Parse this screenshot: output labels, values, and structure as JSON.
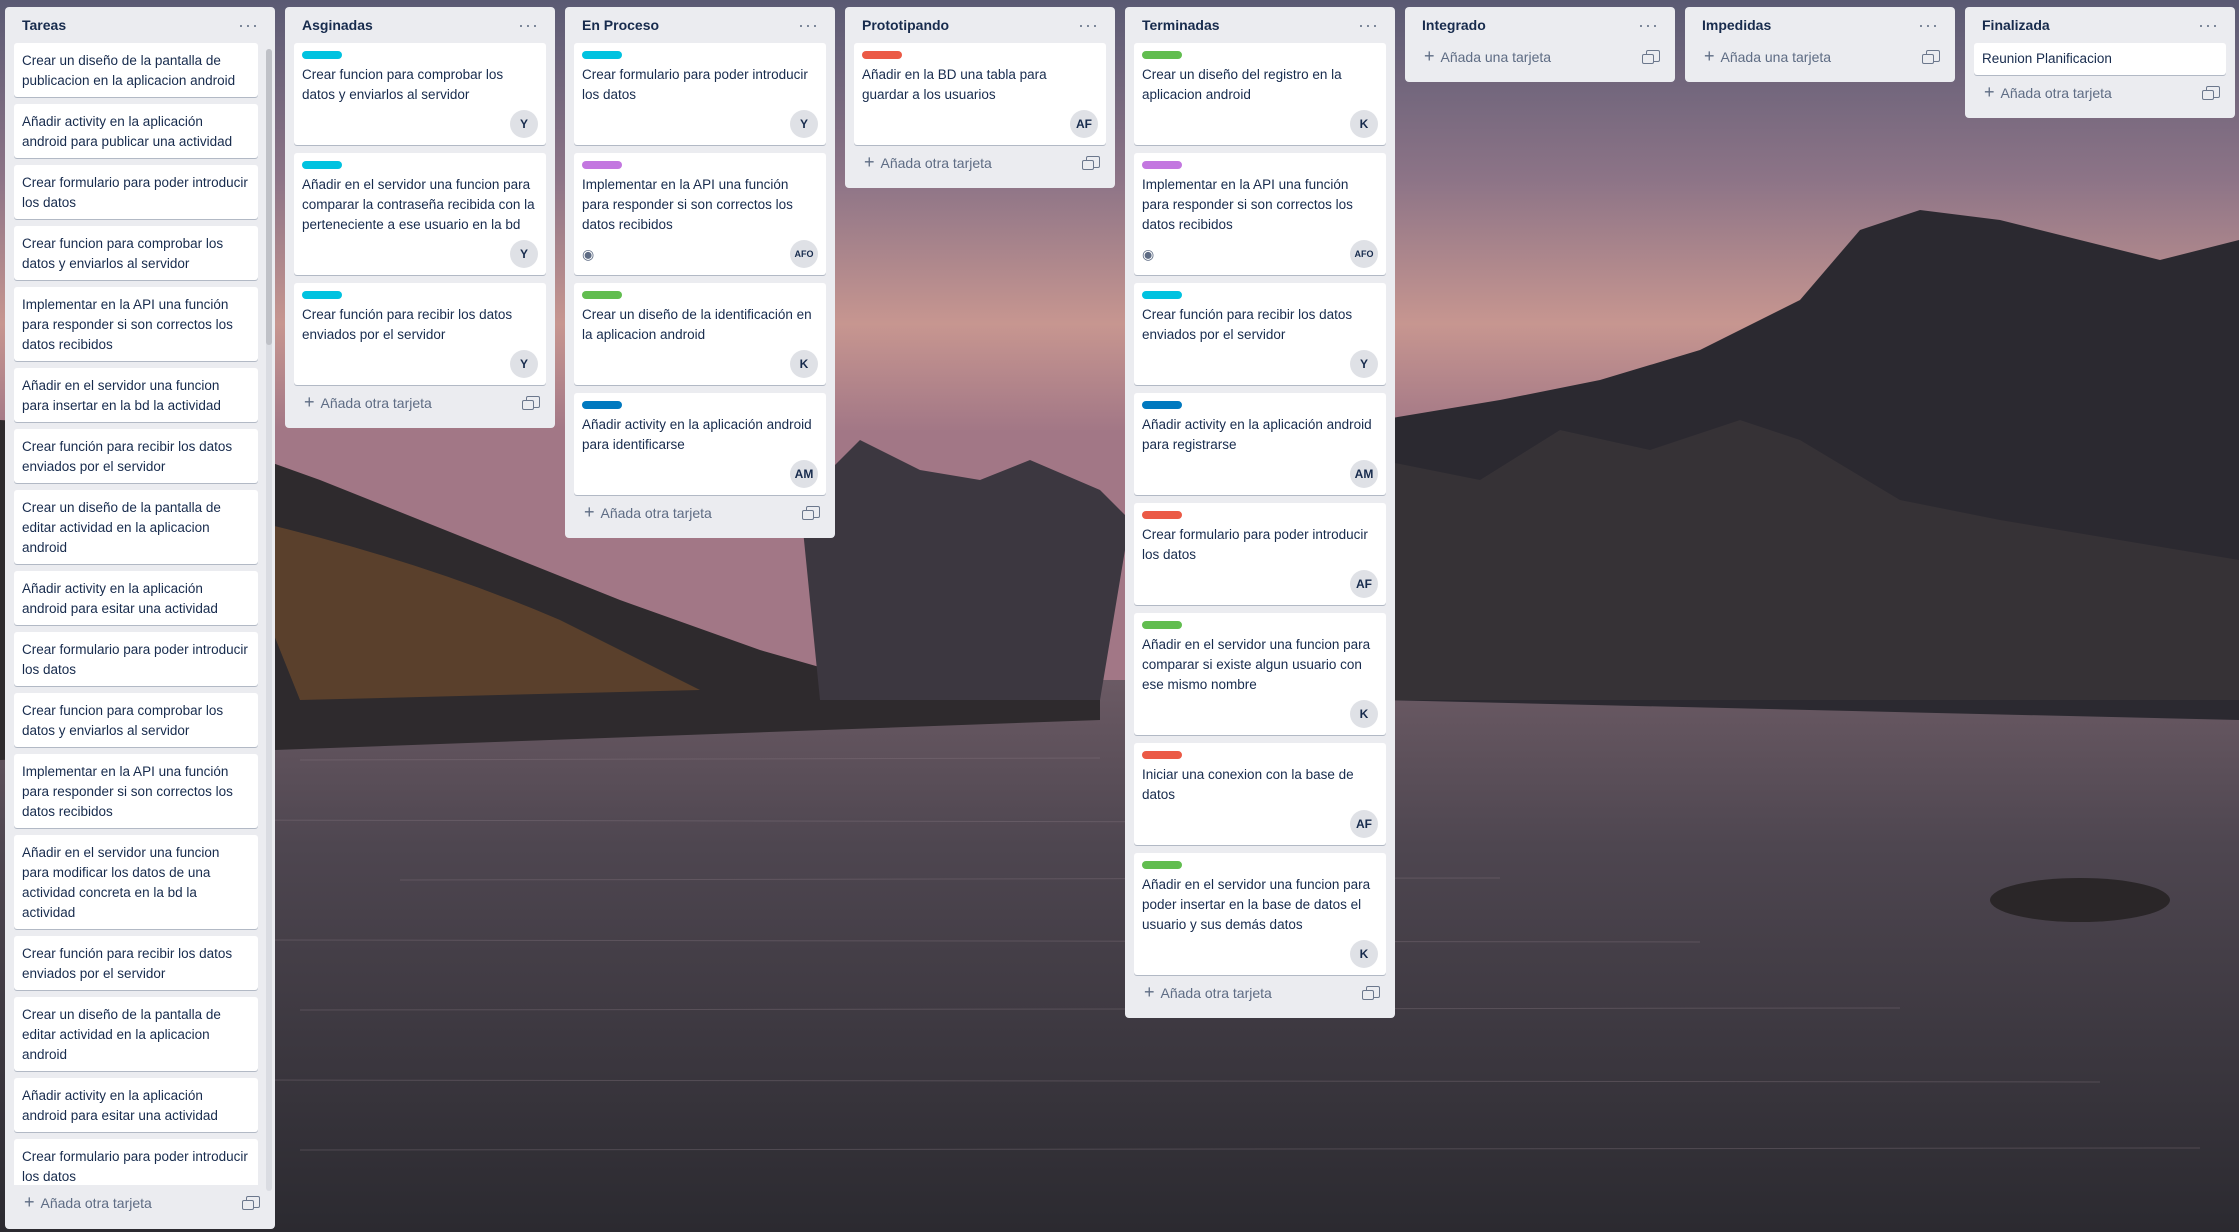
{
  "lists": [
    {
      "title": "Tareas",
      "add_label": "Añada otra tarjeta",
      "cards": [
        {
          "title": "Crear un diseño de la pantalla de publicacion en la aplicacion android"
        },
        {
          "title": "Añadir activity en la aplicación android para publicar una actividad"
        },
        {
          "title": "Crear formulario para poder introducir los datos"
        },
        {
          "title": "Crear funcion para comprobar los datos y enviarlos al servidor"
        },
        {
          "title": "Implementar en la API una función para responder si son correctos los datos recibidos"
        },
        {
          "title": "Añadir en el servidor una funcion para insertar en la bd la actividad"
        },
        {
          "title": "Crear función para recibir los datos enviados por el servidor"
        },
        {
          "title": "Crear un diseño de la pantalla de editar actividad en la aplicacion android"
        },
        {
          "title": "Añadir activity en la aplicación android para esitar una actividad"
        },
        {
          "title": "Crear formulario para poder introducir los datos"
        },
        {
          "title": "Crear funcion para comprobar los datos y enviarlos al servidor"
        },
        {
          "title": "Implementar en la API una función para responder si son correctos los datos recibidos"
        },
        {
          "title": "Añadir en el servidor una funcion para modificar los datos de una actividad concreta en la bd la actividad"
        },
        {
          "title": "Crear función para recibir los datos enviados por el servidor"
        },
        {
          "title": "Crear un diseño de la pantalla de editar actividad en la aplicacion android"
        },
        {
          "title": "Añadir activity en la aplicación android para esitar una actividad"
        },
        {
          "title": "Crear formulario para poder introducir los datos"
        }
      ]
    },
    {
      "title": "Asginadas",
      "add_label": "Añada otra tarjeta",
      "cards": [
        {
          "label_color": "#00c2e0",
          "title": "Crear funcion para comprobar los datos y enviarlos al servidor",
          "avatar": "Y"
        },
        {
          "label_color": "#00c2e0",
          "title": "Añadir en el servidor una funcion para comparar la contraseña recibida con la perteneciente a ese usuario en la bd",
          "avatar": "Y"
        },
        {
          "label_color": "#00c2e0",
          "title": "Crear función para recibir los datos enviados por el servidor",
          "avatar": "Y"
        }
      ]
    },
    {
      "title": "En Proceso",
      "add_label": "Añada otra tarjeta",
      "cards": [
        {
          "label_color": "#00c2e0",
          "title": "Crear formulario para poder introducir los datos",
          "avatar": "Y"
        },
        {
          "label_color": "#c377e0",
          "title": "Implementar en la API una función para responder si son correctos los datos recibidos",
          "avatar": "AFO",
          "eye": "◉"
        },
        {
          "label_color": "#61bd4f",
          "title": "Crear un diseño de la identificación en la aplicacion android",
          "avatar": "K"
        },
        {
          "label_color": "#0079bf",
          "title": "Añadir activity en la aplicación android para identificarse",
          "avatar": "AM"
        }
      ]
    },
    {
      "title": "Prototipando",
      "add_label": "Añada otra tarjeta",
      "cards": [
        {
          "label_color": "#eb5a46",
          "title": "Añadir en la BD una tabla para guardar a los usuarios",
          "avatar": "AF"
        }
      ]
    },
    {
      "title": "Terminadas",
      "add_label": "Añada otra tarjeta",
      "cards": [
        {
          "label_color": "#61bd4f",
          "title": "Crear un diseño del registro en la aplicacion android",
          "avatar": "K"
        },
        {
          "label_color": "#c377e0",
          "title": "Implementar en la API una función para responder si son correctos los datos recibidos",
          "avatar": "AFO",
          "eye": "◉"
        },
        {
          "label_color": "#00c2e0",
          "title": "Crear función para recibir los datos enviados por el servidor",
          "avatar": "Y"
        },
        {
          "label_color": "#0079bf",
          "title": "Añadir activity en la aplicación android para registrarse",
          "avatar": "AM"
        },
        {
          "label_color": "#eb5a46",
          "title": "Crear formulario para poder introducir los datos",
          "avatar": "AF"
        },
        {
          "label_color": "#61bd4f",
          "title": "Añadir en el servidor una funcion para comparar si existe algun usuario con ese mismo nombre",
          "avatar": "K"
        },
        {
          "label_color": "#eb5a46",
          "title": "Iniciar una conexion con la base de datos",
          "avatar": "AF"
        },
        {
          "label_color": "#61bd4f",
          "title": "Añadir en el servidor una funcion para poder insertar en la base de datos el usuario y sus demás datos",
          "avatar": "K"
        }
      ]
    },
    {
      "title": "Integrado",
      "add_label": "Añada una tarjeta",
      "cards": []
    },
    {
      "title": "Impedidas",
      "add_label": "Añada una tarjeta",
      "cards": []
    },
    {
      "title": "Finalizada",
      "add_label": "Añada otra tarjeta",
      "cards": [
        {
          "title": "Reunion Planificacion",
          "compact": true
        }
      ]
    }
  ]
}
